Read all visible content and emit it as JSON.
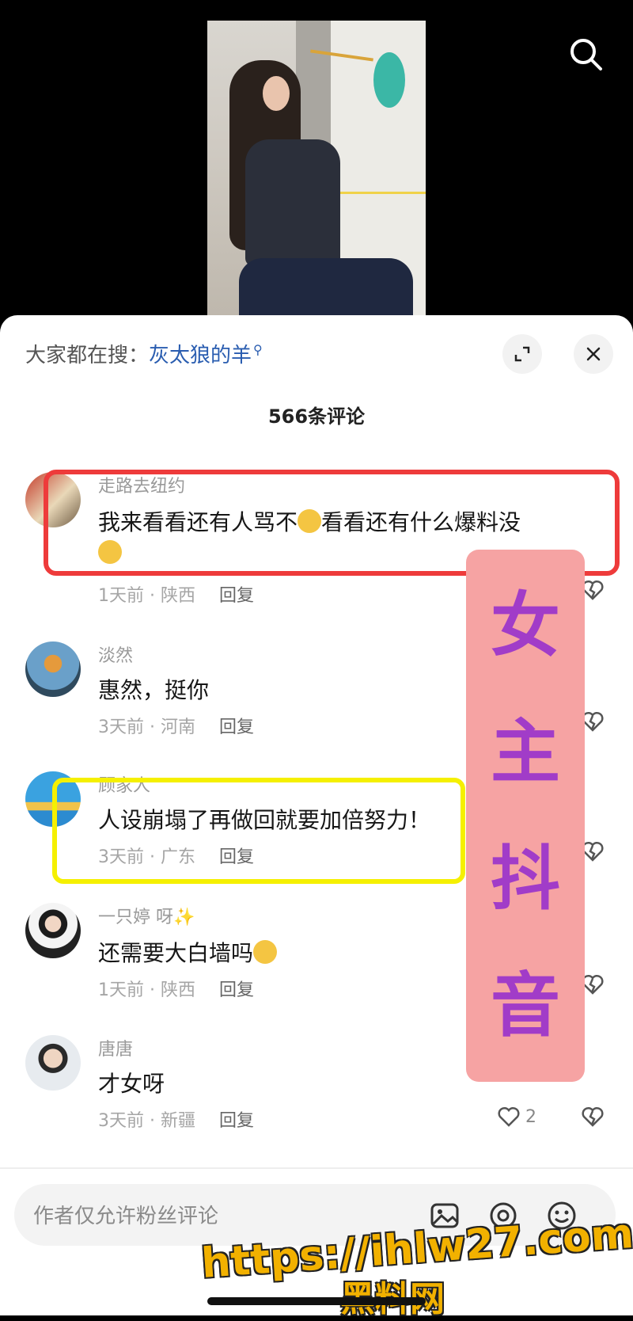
{
  "video": {},
  "hot_search": {
    "prefix": "大家都在搜：",
    "term": "灰太狼的羊"
  },
  "comment_count": "566条评论",
  "comments": [
    {
      "username": "走路去纽约",
      "text_a": "我来看看还有人骂不",
      "text_b": "看看还有什么爆料没",
      "meta": "1天前 · 陕西",
      "reply": "回复"
    },
    {
      "username": "淡然",
      "text": "惠然，挺你",
      "meta": "3天前 · 河南",
      "reply": "回复"
    },
    {
      "username": "顾家人",
      "text": "人设崩塌了再做回就要加倍努力！",
      "meta": "3天前 · 广东",
      "reply": "回复"
    },
    {
      "username": "一只婷 呀",
      "text": "还需要大白墙吗",
      "meta": "1天前 · 陕西",
      "reply": "回复"
    },
    {
      "username": "唐唐",
      "text": "才女呀",
      "meta": "3天前 · 新疆",
      "reply": "回复",
      "likes": "2"
    }
  ],
  "banner": {
    "chars": [
      "女",
      "主",
      "抖",
      "音"
    ]
  },
  "composer": {
    "placeholder": "作者仅允许粉丝评论"
  },
  "watermark": {
    "url": "https://ihlw27.com",
    "name": "黑料网"
  },
  "colors": {
    "red_box": "#ee3b3b",
    "yellow_box": "#f5f000",
    "banner_bg": "#f6a3a3",
    "banner_text": "#a13cc8",
    "link": "#2a5db0"
  }
}
